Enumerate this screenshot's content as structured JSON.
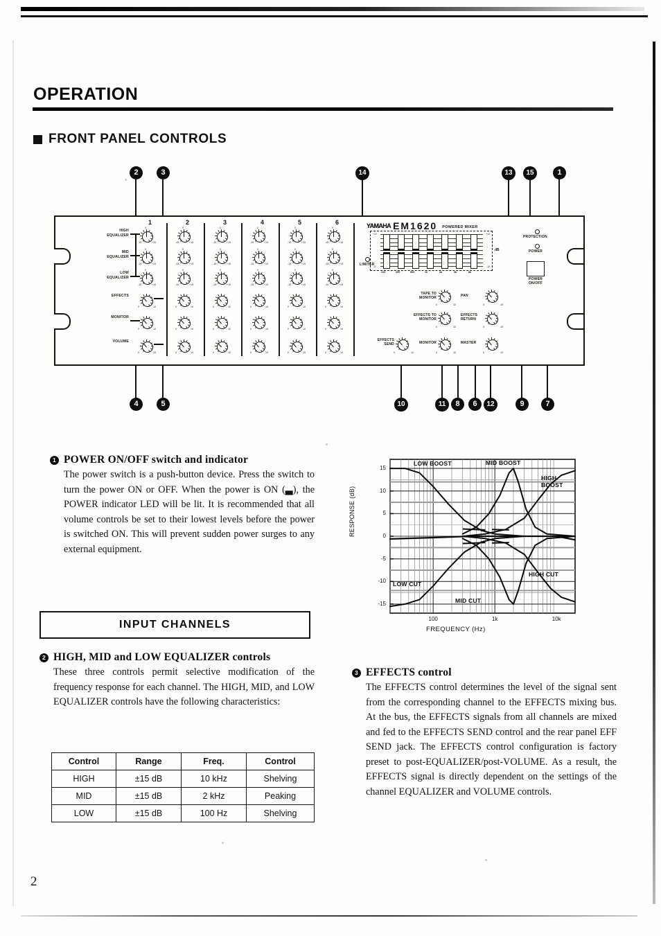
{
  "page": {
    "number": "2",
    "section_title": "OPERATION",
    "subsection_title": "FRONT PANEL CONTROLS"
  },
  "diagram": {
    "brand": "YAMAHA",
    "model": "EM1620",
    "model_suffix": "POWERED MIXER",
    "channel_numbers": [
      "1",
      "2",
      "3",
      "4",
      "5",
      "6"
    ],
    "row_labels": [
      "HIGH\nEQUALIZER",
      "MID\nEQUALIZER",
      "LOW\nEQUALIZER",
      "EFFECTS",
      "MONITOR",
      "VOLUME"
    ],
    "eq_knob_scale": {
      "min": "-15",
      "center": "0",
      "max": "+15"
    },
    "level_knob_scale": {
      "min": "0",
      "center": "5",
      "max": "10"
    },
    "graphic_eq": {
      "bands": [
        "125",
        "250",
        "500",
        "1k",
        "2k",
        "4k",
        "8k"
      ],
      "scale_top": "+12",
      "scale_bottom": "-12",
      "scale_values": [
        "+12",
        "9",
        "6",
        "3",
        "0",
        "3",
        "6",
        "9",
        "-12"
      ],
      "unit": "dB",
      "limiter_label": "LIMITER"
    },
    "master_controls": [
      "TAPE TO\nMONITOR",
      "EFFECTS TO\nMONITOR",
      "EFFECTS\nSEND",
      "MONITOR",
      "EFFECTS\nRETURN",
      "MASTER"
    ],
    "power_section": {
      "protection_label": "PROTECTION",
      "power_led_label": "POWER",
      "power_switch_label": "POWER",
      "power_switch_sub": "ON/OFF"
    },
    "callouts_top": [
      "2",
      "3",
      "14",
      "13",
      "15",
      "1"
    ],
    "callouts_bottom": [
      "4",
      "5",
      "10",
      "11",
      "8",
      "6",
      "12",
      "9",
      "7"
    ]
  },
  "sections": {
    "power": {
      "number": "1",
      "title": "POWER ON/OFF switch and indicator",
      "body": "The power switch is a push-button device. Press the switch to turn the power ON or OFF. When the power is ON (▃), the POWER indicator LED will be lit. It is recommended that all volume controls be set to their lowest levels before the power is switched ON. This will prevent sudden power surges to any external equipment."
    },
    "input_channels_header": "INPUT CHANNELS",
    "equalizer": {
      "number": "2",
      "title": "HIGH, MID and LOW EQUALIZER controls",
      "body": "These three controls permit selective modification of the frequency response for each channel. The HIGH, MID, and LOW EQUALIZER controls have the following characteristics:"
    },
    "effects": {
      "number": "3",
      "title": "EFFECTS control",
      "body": "The EFFECTS control determines the level of the signal sent from the corresponding channel to the EFFECTS mixing bus. At the bus, the EFFECTS signals from all channels are mixed and fed to the EFFECTS SEND control and the rear panel EFF SEND jack. The EFFECTS control configuration is factory preset to post-EQUALIZER/post-VOLUME. As a result, the EFFECTS signal is directly dependent on the settings of the channel EQUALIZER and VOLUME controls."
    }
  },
  "spec_table": {
    "headers": [
      "Control",
      "Range",
      "Freq.",
      "Control"
    ],
    "rows": [
      [
        "HIGH",
        "±15 dB",
        "10 kHz",
        "Shelving"
      ],
      [
        "MID",
        "±15 dB",
        "2 kHz",
        "Peaking"
      ],
      [
        "LOW",
        "±15 dB",
        "100 Hz",
        "Shelving"
      ]
    ]
  },
  "chart_data": {
    "type": "line",
    "title": "",
    "xlabel": "FREQUENCY (Hz)",
    "ylabel": "RESPONSE (dB)",
    "xscale": "log",
    "xlim": [
      20,
      20000
    ],
    "ylim": [
      -17,
      17
    ],
    "yticks": [
      15,
      10,
      5,
      0,
      -5,
      -10,
      -15
    ],
    "ytick_labels": [
      "15",
      "10",
      "5",
      "0",
      "-5",
      "-10",
      "-15"
    ],
    "xticks": [
      100,
      1000,
      10000
    ],
    "xtick_labels": [
      "100",
      "1k",
      "10k"
    ],
    "grid": true,
    "annotations": [
      "LOW BOOST",
      "MID BOOST",
      "HIGH BOOST",
      "LOW CUT",
      "MID CUT",
      "HIGH CUT"
    ],
    "series": [
      {
        "name": "LOW BOOST",
        "points": [
          [
            20,
            15
          ],
          [
            35,
            15
          ],
          [
            60,
            14
          ],
          [
            100,
            11
          ],
          [
            180,
            7
          ],
          [
            320,
            3.5
          ],
          [
            600,
            1.3
          ],
          [
            1000,
            0.5
          ],
          [
            3000,
            0
          ],
          [
            20000,
            0
          ]
        ]
      },
      {
        "name": "LOW CUT",
        "points": [
          [
            20,
            -15.5
          ],
          [
            35,
            -15
          ],
          [
            60,
            -14
          ],
          [
            100,
            -11
          ],
          [
            180,
            -7
          ],
          [
            320,
            -3.5
          ],
          [
            600,
            -1.3
          ],
          [
            1000,
            -0.5
          ],
          [
            3000,
            0
          ],
          [
            20000,
            0
          ]
        ]
      },
      {
        "name": "MID BOOST",
        "points": [
          [
            300,
            0.5
          ],
          [
            500,
            2
          ],
          [
            800,
            5
          ],
          [
            1200,
            9
          ],
          [
            1700,
            14
          ],
          [
            2000,
            15
          ],
          [
            2400,
            12
          ],
          [
            3200,
            6
          ],
          [
            4500,
            2
          ],
          [
            7000,
            0.5
          ],
          [
            20000,
            0
          ]
        ]
      },
      {
        "name": "MID CUT",
        "points": [
          [
            300,
            -0.5
          ],
          [
            500,
            -2
          ],
          [
            800,
            -5
          ],
          [
            1200,
            -9
          ],
          [
            1700,
            -14
          ],
          [
            2000,
            -15
          ],
          [
            2400,
            -12
          ],
          [
            3200,
            -6
          ],
          [
            4500,
            -2
          ],
          [
            7000,
            -0.5
          ],
          [
            20000,
            0
          ]
        ]
      },
      {
        "name": "HIGH BOOST",
        "points": [
          [
            300,
            0
          ],
          [
            700,
            0.5
          ],
          [
            1500,
            1.5
          ],
          [
            3000,
            4
          ],
          [
            5000,
            8
          ],
          [
            8000,
            11.5
          ],
          [
            12000,
            13.5
          ],
          [
            20000,
            14.5
          ]
        ]
      },
      {
        "name": "HIGH CUT",
        "points": [
          [
            300,
            0
          ],
          [
            700,
            -0.5
          ],
          [
            1500,
            -1.5
          ],
          [
            3000,
            -4
          ],
          [
            5000,
            -8
          ],
          [
            8000,
            -11.5
          ],
          [
            12000,
            -13.5
          ],
          [
            20000,
            -14.5
          ]
        ]
      },
      {
        "name": "FLAT",
        "points": [
          [
            20,
            -0.6
          ],
          [
            100,
            -0.3
          ],
          [
            400,
            0
          ],
          [
            2000,
            0
          ],
          [
            10000,
            0
          ],
          [
            20000,
            -0.8
          ]
        ]
      }
    ]
  }
}
